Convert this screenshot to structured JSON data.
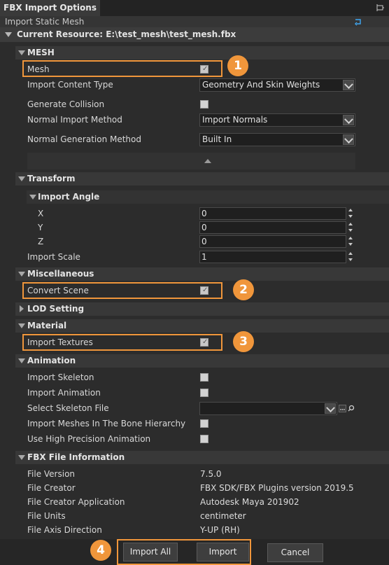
{
  "window": {
    "title": "FBX Import Options",
    "subtitle": "Import Static Mesh",
    "current_resource": "Current Resource: E:\\test_mesh\\test_mesh.fbx"
  },
  "sections": {
    "mesh": {
      "title": "MESH",
      "mesh_label": "Mesh",
      "mesh_checked": true,
      "import_content_type_label": "Import Content Type",
      "import_content_type_value": "Geometry And Skin Weights",
      "generate_collision_label": "Generate Collision",
      "generate_collision_checked": false,
      "normal_import_method_label": "Normal Import Method",
      "normal_import_method_value": "Import Normals",
      "normal_generation_method_label": "Normal Generation Method",
      "normal_generation_method_value": "Built In"
    },
    "transform": {
      "title": "Transform",
      "import_angle_title": "Import Angle",
      "x_label": "X",
      "x_value": "0",
      "y_label": "Y",
      "y_value": "0",
      "z_label": "Z",
      "z_value": "0",
      "import_scale_label": "Import Scale",
      "import_scale_value": "1"
    },
    "misc": {
      "title": "Miscellaneous",
      "convert_scene_label": "Convert Scene",
      "convert_scene_checked": true
    },
    "lod": {
      "title": "LOD Setting"
    },
    "material": {
      "title": "Material",
      "import_textures_label": "Import Textures",
      "import_textures_checked": true
    },
    "animation": {
      "title": "Animation",
      "import_skeleton_label": "Import Skeleton",
      "import_skeleton_checked": false,
      "import_animation_label": "Import Animation",
      "import_animation_checked": false,
      "select_skeleton_label": "Select Skeleton File",
      "select_skeleton_value": "",
      "import_meshes_bone_label": "Import Meshes In The Bone Hierarchy",
      "import_meshes_bone_checked": false,
      "high_precision_label": "Use High Precision Animation",
      "high_precision_checked": false
    },
    "fbx_info": {
      "title": "FBX File Information",
      "file_version_label": "File Version",
      "file_version_value": "7.5.0",
      "file_creator_label": "File Creator",
      "file_creator_value": "FBX SDK/FBX Plugins version 2019.5",
      "file_creator_app_label": "File Creator Application",
      "file_creator_app_value": "Autodesk Maya 201902",
      "file_units_label": "File Units",
      "file_units_value": "centimeter",
      "file_axis_label": "File Axis Direction",
      "file_axis_value": "Y-UP (RH)"
    }
  },
  "buttons": {
    "import_all": "Import All",
    "import": "Import",
    "cancel": "Cancel"
  },
  "callouts": {
    "one": "1",
    "two": "2",
    "three": "3",
    "four": "4"
  },
  "colors": {
    "accent": "#f0963b",
    "background": "#2c2c2c"
  }
}
